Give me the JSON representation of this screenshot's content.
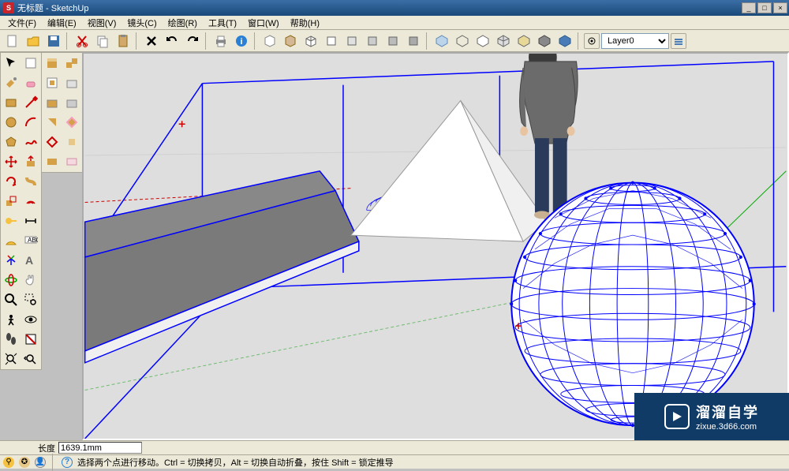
{
  "title": "无标题 - SketchUp",
  "menu": {
    "file": "文件(F)",
    "edit": "编辑(E)",
    "view": "视图(V)",
    "camera": "镜头(C)",
    "draw": "绘图(R)",
    "tools": "工具(T)",
    "window": "窗口(W)",
    "help": "帮助(H)"
  },
  "layer": {
    "selected": "Layer0"
  },
  "measure": {
    "label": "长度",
    "value": "1639.1mm"
  },
  "status": {
    "hint": "选择两个点进行移动。Ctrl = 切换拷贝，Alt = 切换自动折叠，按住 Shift = 锁定推导"
  },
  "watermark": {
    "brand": "溜溜自学",
    "url": "zixue.3d66.com"
  },
  "colors": {
    "selection_blue": "#0000ff",
    "axis_red": "#cc0000",
    "axis_green": "#00aa00",
    "ground": "#dedede"
  }
}
